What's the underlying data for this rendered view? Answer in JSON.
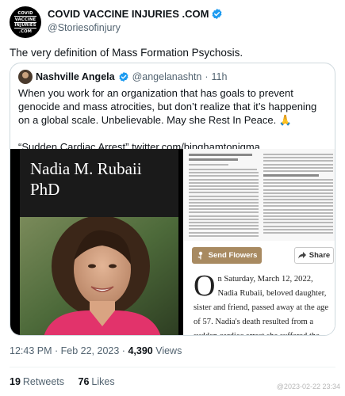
{
  "author": {
    "avatar_lines": [
      "COVID",
      "VACCINE",
      "INJURIES",
      ".COM"
    ],
    "display_name": "COVID VACCINE INJURIES .COM",
    "handle": "@Storiesofinjury"
  },
  "tweet": {
    "text": "The very definition of Mass Formation Psychosis."
  },
  "quoted": {
    "display_name": "Nashville Angela",
    "handle": "@angelanashtn",
    "separator": "·",
    "time": "11h",
    "text_line1": "When you work for an organization that has goals to prevent genocide and mass atrocities, but don’t realize that it’s happening on a global scale. Unbelievable. May she Rest In Peace. 🙏",
    "text_line2": "“Sudden Cardiac Arrest”  twitter.com/binghamtonigma…",
    "media": {
      "photo_name_line1": "Nadia M. Rubaii",
      "photo_name_line2": "PhD",
      "send_flowers_label": "Send Flowers",
      "share_label": "Share",
      "article_dropcap": "O",
      "article_text": "n Saturday, March 12, 2022, Nadia Rubaii, beloved daughter, sister and friend, passed away at the age of 57. Nadia's death resulted from a sudden cardiac arrest she suffered the previous week. Nadia was"
    }
  },
  "meta": {
    "time": "12:43 PM",
    "date": "Feb 22, 2023",
    "views_count": "4,390",
    "views_label": "Views"
  },
  "stats": {
    "retweets_count": "19",
    "retweets_label": "Retweets",
    "likes_count": "76",
    "likes_label": "Likes"
  },
  "watermark": "@2023-02-22 23:34",
  "colors": {
    "verified": "#1d9bf0",
    "flowers_button": "#a88a61"
  },
  "icons": [
    "verified-badge-icon",
    "flower-icon",
    "share-icon"
  ]
}
